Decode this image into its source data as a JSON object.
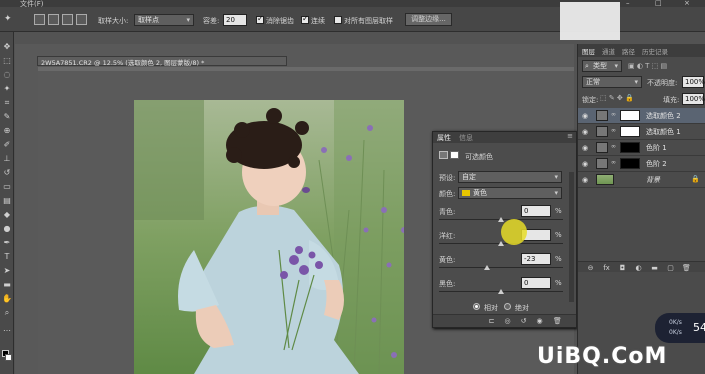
{
  "menubar": {
    "file": "文件(F)"
  },
  "options_bar": {
    "sample_size_label": "取样大小:",
    "sample_size_value": "取样点",
    "tolerance_label": "容差:",
    "tolerance_value": "20",
    "antialias_label": "消除锯齿",
    "antialias_checked": true,
    "contiguous_label": "连续",
    "contiguous_checked": true,
    "sample_all_layers_label": "对所有图层取样",
    "sample_all_layers_checked": false,
    "refine_edge_label": "调整边缘..."
  },
  "document": {
    "tab_title": "2W5A7851.CR2 @ 12.5% (选取颜色 2, 图层蒙版/8) *"
  },
  "properties_panel": {
    "tabs": [
      "属性",
      "信息"
    ],
    "adjustment_title": "可选颜色",
    "preset_label": "预设:",
    "preset_value": "自定",
    "colors_label": "颜色:",
    "colors_value": "黄色",
    "colors_swatch": "#e8c600",
    "sliders": [
      {
        "label": "青色:",
        "value": "0",
        "unit": "%",
        "level": 0
      },
      {
        "label": "洋红:",
        "value": "",
        "unit": "%",
        "level": 0
      },
      {
        "label": "黄色:",
        "value": "-23",
        "unit": "%",
        "level": -23
      },
      {
        "label": "黑色:",
        "value": "0",
        "unit": "%",
        "level": 0
      }
    ],
    "method_relative": "相对",
    "method_absolute": "绝对",
    "method_selected": "relative"
  },
  "layers_panel": {
    "tabs": [
      "图层",
      "通道",
      "路径",
      "历史记录"
    ],
    "filter_kind": "类型",
    "blend_mode": "正常",
    "opacity_label": "不透明度:",
    "opacity_value": "100%",
    "lock_label": "锁定:",
    "fill_label": "填充:",
    "fill_value": "100%",
    "layers": [
      {
        "name": "选取颜色 2",
        "selected": true,
        "mask": "white"
      },
      {
        "name": "选取颜色 1",
        "selected": false,
        "mask": "white"
      },
      {
        "name": "色阶 1",
        "selected": false,
        "mask": "black"
      },
      {
        "name": "色阶 2",
        "selected": false,
        "mask": "black"
      },
      {
        "name": "背景",
        "selected": false,
        "mask": "photo"
      }
    ]
  },
  "overlay": {
    "watermark": "UiBQ.CoM",
    "speed_down": "0K/s",
    "speed_up": "0K/s",
    "speed_percent": "54"
  },
  "colors": {
    "accent_cursor": "#e6dc28",
    "selected_layer_bg": "#5a6472",
    "panel_bg": "#4c4c4c"
  }
}
